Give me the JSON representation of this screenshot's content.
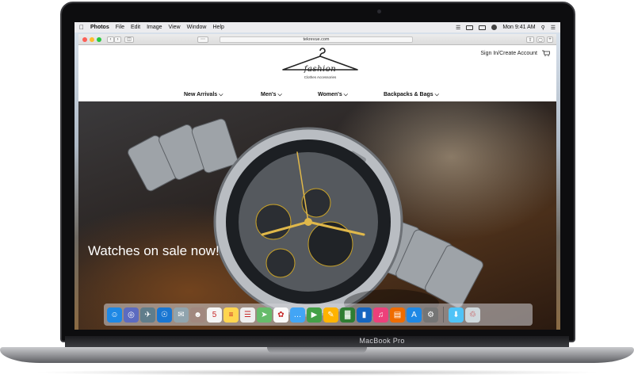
{
  "device": {
    "label": "MacBook Pro"
  },
  "menubar": {
    "app": "Photos",
    "items": [
      "File",
      "Edit",
      "Image",
      "View",
      "Window",
      "Help"
    ],
    "clock": "Mon 9:41 AM"
  },
  "browser": {
    "url": "tekrevue.com"
  },
  "site": {
    "account_link": "Sign In/Create Account",
    "logo_text": "fashion",
    "logo_tagline": "Clothes    Accessories",
    "nav": [
      {
        "label": "New Arrivals ⌵"
      },
      {
        "label": "Men's ⌵"
      },
      {
        "label": "Women's ⌵"
      },
      {
        "label": "Backpacks & Bags ⌵"
      }
    ],
    "hero_text": "Watches on sale now!"
  },
  "dock": {
    "icons": [
      {
        "name": "finder-icon",
        "color": "#1e88e5",
        "glyph": "☺"
      },
      {
        "name": "siri-icon",
        "color": "#5c6bc0",
        "glyph": "◎"
      },
      {
        "name": "launchpad-icon",
        "color": "#607d8b",
        "glyph": "✈"
      },
      {
        "name": "safari-icon",
        "color": "#1976d2",
        "glyph": "☉"
      },
      {
        "name": "mail-icon",
        "color": "#90a4ae",
        "glyph": "✉"
      },
      {
        "name": "contacts-icon",
        "color": "#a1887f",
        "glyph": "☻"
      },
      {
        "name": "calendar-icon",
        "color": "#f5f5f5",
        "glyph": "5"
      },
      {
        "name": "notes-icon",
        "color": "#ffd54f",
        "glyph": "≡"
      },
      {
        "name": "reminders-icon",
        "color": "#eeeeee",
        "glyph": "☰"
      },
      {
        "name": "maps-icon",
        "color": "#66bb6a",
        "glyph": "➤"
      },
      {
        "name": "photos-icon",
        "color": "#fafafa",
        "glyph": "✿"
      },
      {
        "name": "messages-icon",
        "color": "#42a5f5",
        "glyph": "…"
      },
      {
        "name": "facetime-icon",
        "color": "#43a047",
        "glyph": "▶"
      },
      {
        "name": "pages-icon",
        "color": "#ffb300",
        "glyph": "✎"
      },
      {
        "name": "numbers-icon",
        "color": "#2e7d32",
        "glyph": "▓"
      },
      {
        "name": "keynote-icon",
        "color": "#1565c0",
        "glyph": "▮"
      },
      {
        "name": "itunes-icon",
        "color": "#ec407a",
        "glyph": "♫"
      },
      {
        "name": "ibooks-icon",
        "color": "#ef6c00",
        "glyph": "▤"
      },
      {
        "name": "app-store-icon",
        "color": "#1e88e5",
        "glyph": "A"
      },
      {
        "name": "system-preferences-icon",
        "color": "#757575",
        "glyph": "⚙"
      }
    ],
    "right_icons": [
      {
        "name": "downloads-folder-icon",
        "color": "#4fc3f7",
        "glyph": "⬇"
      },
      {
        "name": "trash-icon",
        "color": "#cfd8dc",
        "glyph": "♲"
      }
    ]
  }
}
